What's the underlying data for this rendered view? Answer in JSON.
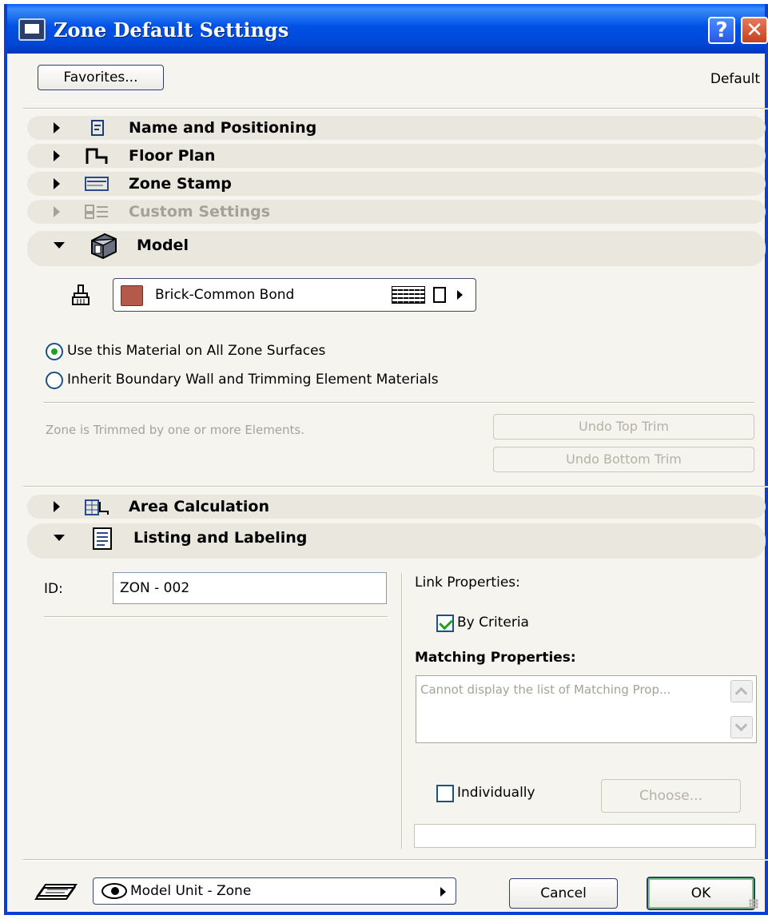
{
  "window": {
    "title": "Zone Default Settings"
  },
  "titlebar": {
    "help_label": "?",
    "close_label": "✕"
  },
  "toolbar": {
    "favorites_label": "Favorites...",
    "default_label": "Default"
  },
  "panels": [
    {
      "label": "Name and Positioning",
      "expanded": false,
      "enabled": true
    },
    {
      "label": "Floor Plan",
      "expanded": false,
      "enabled": true
    },
    {
      "label": "Zone Stamp",
      "expanded": false,
      "enabled": true
    },
    {
      "label": "Custom Settings",
      "expanded": false,
      "enabled": false
    },
    {
      "label": "Model",
      "expanded": true,
      "enabled": true
    },
    {
      "label": "Area Calculation",
      "expanded": false,
      "enabled": true
    },
    {
      "label": "Listing and Labeling",
      "expanded": true,
      "enabled": true
    }
  ],
  "model": {
    "material_name": "Brick-Common Bond",
    "material_color": "#b55a4a",
    "option_all_surfaces": "Use this Material on All Zone Surfaces",
    "option_inherit": "Inherit Boundary Wall and Trimming Element Materials",
    "selected_option": "all_surfaces",
    "trim_message": "Zone is Trimmed by one or more Elements.",
    "undo_top_label": "Undo Top Trim",
    "undo_bottom_label": "Undo Bottom Trim"
  },
  "listing": {
    "id_label": "ID:",
    "id_value": "ZON - 002",
    "link_properties_label": "Link Properties:",
    "by_criteria_label": "By Criteria",
    "by_criteria_checked": true,
    "matching_label": "Matching Properties:",
    "matching_placeholder": "Cannot display the list of Matching Prop...",
    "individually_label": "Individually",
    "individually_checked": false,
    "choose_label": "Choose..."
  },
  "footer": {
    "model_unit_label": "Model Unit - Zone",
    "cancel_label": "Cancel",
    "ok_label": "OK"
  }
}
